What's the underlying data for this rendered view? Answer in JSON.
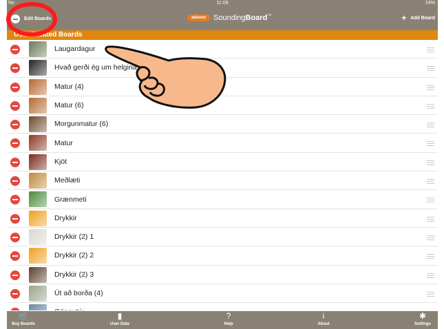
{
  "status_bar": {
    "carrier": "No",
    "time": "11:09",
    "battery": "24%"
  },
  "nav": {
    "edit_label": "Edit Boards",
    "logo": "ablenet",
    "brand": "Sounding",
    "brand_bold": "Board",
    "brand_mark": "™",
    "add_label": "Add Board"
  },
  "section_title": "User Created Boards",
  "boards": [
    {
      "label": "Laugardagur",
      "icon": "calendar-photo-icon",
      "color": "#6c7a5a"
    },
    {
      "label": "Hvað gerði ég um helgina",
      "icon": "walking-people-icon",
      "color": "#222222"
    },
    {
      "label": "Matur (4)",
      "icon": "burger-icon",
      "color": "#b66a2e"
    },
    {
      "label": "Matur (6)",
      "icon": "burger-icon",
      "color": "#b66a2e"
    },
    {
      "label": "Morgunmatur (6)",
      "icon": "breakfast-bowl-icon",
      "color": "#6e4a2e"
    },
    {
      "label": "Matur",
      "icon": "grill-food-icon",
      "color": "#8a3a22"
    },
    {
      "label": "Kjöt",
      "icon": "meat-icon",
      "color": "#7a2a1e"
    },
    {
      "label": "Meðlæti",
      "icon": "pasta-icon",
      "color": "#c08a3a"
    },
    {
      "label": "Grænmeti",
      "icon": "vegetables-icon",
      "color": "#4a8a3a"
    },
    {
      "label": "Drykkir",
      "icon": "juice-icon",
      "color": "#f0a020"
    },
    {
      "label": "Drykkir (2) 1",
      "icon": "milk-icon",
      "color": "#d8d8d0"
    },
    {
      "label": "Drykkir (2) 2",
      "icon": "juice-icon",
      "color": "#f0a020"
    },
    {
      "label": "Drykkir (2) 3",
      "icon": "coffee-icon",
      "color": "#5a4030"
    },
    {
      "label": "Út að borða (4)",
      "icon": "restaurant-sign-icon",
      "color": "#9aa28a"
    },
    {
      "label": "Göngutúr",
      "icon": "landscape-icon",
      "color": "#6a8aa2"
    }
  ],
  "tabs": [
    {
      "label": "Buy Boards",
      "icon": "cart-icon",
      "glyph": "🛒"
    },
    {
      "label": "User Data",
      "icon": "bar-chart-icon",
      "glyph": "▮"
    },
    {
      "label": "Help",
      "icon": "help-icon",
      "glyph": "?"
    },
    {
      "label": "About",
      "icon": "info-icon",
      "glyph": "i"
    },
    {
      "label": "Settings",
      "icon": "gear-icon",
      "glyph": "✱"
    }
  ]
}
